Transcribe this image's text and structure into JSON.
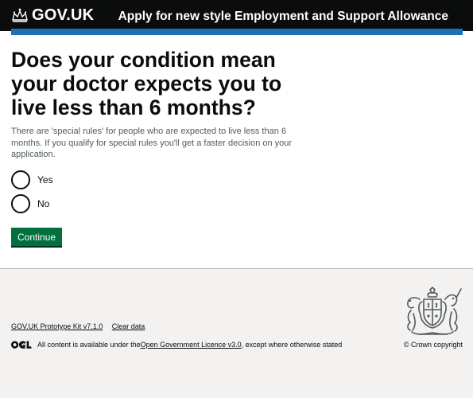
{
  "header": {
    "brand": "GOV.UK",
    "service_name": "Apply for new style Employment and Support Allowance"
  },
  "question": {
    "title": "Does your condition mean your doctor expects you to live less than 6 months?",
    "hint": "There are 'special rules' for people who are expected to live less than 6 months. If you qualify for special rules you'll get a faster decision on your application."
  },
  "options": [
    {
      "label": "Yes",
      "selected": false
    },
    {
      "label": "No",
      "selected": false
    }
  ],
  "continue_label": "Continue",
  "footer": {
    "links": [
      "GOV.UK Prototype Kit v7.1.0",
      "Clear data"
    ],
    "licence_prefix": "All content is available under the ",
    "licence_link": "Open Government Licence v3.0",
    "licence_suffix": ", except where otherwise stated",
    "copyright": "© Crown copyright"
  },
  "colors": {
    "header_bg": "#0b0c0c",
    "header_bar": "#1d70b8",
    "button_bg": "#00703c",
    "footer_bg": "#f3f2f1",
    "hint_text": "#505a5f"
  },
  "icons": [
    "crown-icon",
    "ogl-logo-icon",
    "royal-coat-of-arms-icon"
  ]
}
